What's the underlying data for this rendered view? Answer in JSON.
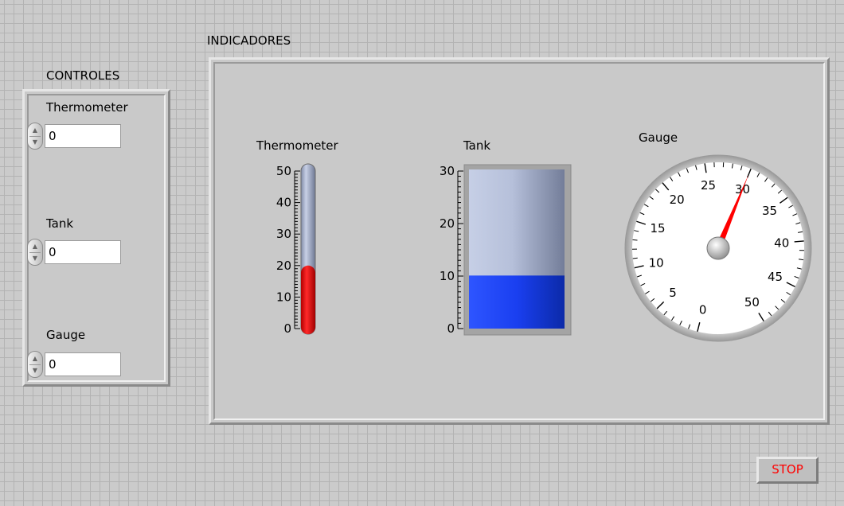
{
  "controls": {
    "title": "CONTROLES",
    "thermometer": {
      "label": "Thermometer",
      "value": "0"
    },
    "tank": {
      "label": "Tank",
      "value": "0"
    },
    "gauge": {
      "label": "Gauge",
      "value": "0"
    }
  },
  "indicators": {
    "title": "INDICADORES",
    "thermometer": {
      "label": "Thermometer",
      "value": 20,
      "min": 0,
      "max": 50,
      "ticks": [
        "0",
        "10",
        "20",
        "30",
        "40",
        "50"
      ],
      "fill_color": "#ff0000"
    },
    "tank": {
      "label": "Tank",
      "value": 10,
      "min": 0,
      "max": 30,
      "ticks": [
        "0",
        "10",
        "20",
        "30"
      ],
      "fill_color": "#1a3ff0"
    },
    "gauge": {
      "label": "Gauge",
      "value": 30,
      "min": 0,
      "max": 50,
      "ticks": [
        "0",
        "5",
        "10",
        "15",
        "20",
        "25",
        "30",
        "35",
        "40",
        "45",
        "50"
      ],
      "needle_color": "#ff0000"
    }
  },
  "stop_button": {
    "label": "STOP",
    "color": "#ff0000"
  }
}
